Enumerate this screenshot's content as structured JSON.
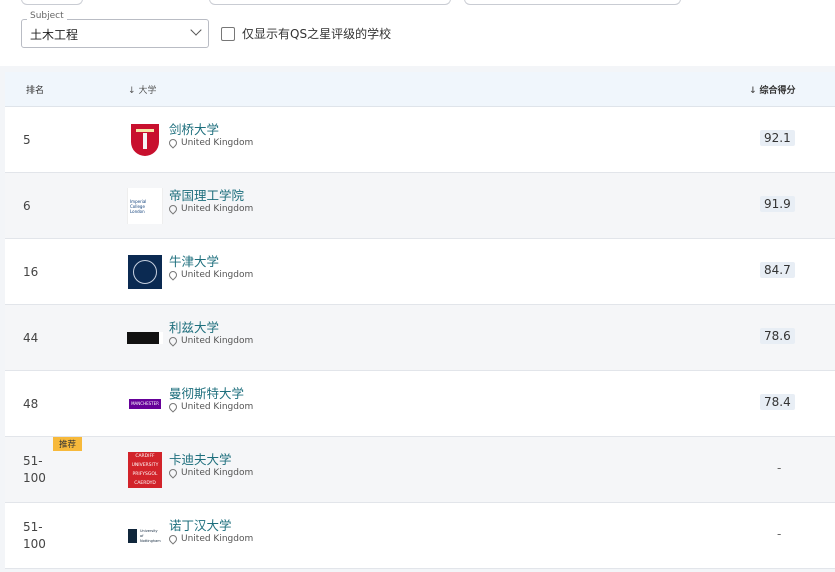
{
  "subject": {
    "label": "Subject",
    "value": "土木工程"
  },
  "filter": {
    "label": "仅显示有QS之星评级的学校",
    "checked": false
  },
  "table": {
    "headers": {
      "rank": "排名",
      "university": "大学",
      "score": "综合得分"
    },
    "rows": [
      {
        "rank": "5",
        "name": "剑桥大学",
        "location": "United Kingdom",
        "score": "92.1",
        "logo": "cambridge-crest"
      },
      {
        "rank": "6",
        "name": "帝国理工学院",
        "location": "United Kingdom",
        "score": "91.9",
        "logo": "imperial-logo",
        "logo_text": [
          "Imperial College",
          "London"
        ]
      },
      {
        "rank": "16",
        "name": "牛津大学",
        "location": "United Kingdom",
        "score": "84.7",
        "logo": "oxford-crest"
      },
      {
        "rank": "44",
        "name": "利兹大学",
        "location": "United Kingdom",
        "score": "78.6",
        "logo": "leeds-logo"
      },
      {
        "rank": "48",
        "name": "曼彻斯特大学",
        "location": "United Kingdom",
        "score": "78.4",
        "logo": "manchester-logo",
        "logo_text": "MANCHESTER"
      },
      {
        "rank_line1": "51-",
        "rank_line2": "100",
        "name": "卡迪夫大学",
        "location": "United Kingdom",
        "score": "-",
        "logo": "cardiff-logo",
        "badge": "推荐",
        "logo_text": [
          "CARDIFF",
          "UNIVERSITY",
          "PRIFYSGOL",
          "CAERDYD"
        ]
      },
      {
        "rank_line1": "51-",
        "rank_line2": "100",
        "name": "诺丁汉大学",
        "location": "United Kingdom",
        "score": "-",
        "logo": "nottingham-logo",
        "logo_text": [
          "University of",
          "Nottingham"
        ]
      }
    ]
  }
}
